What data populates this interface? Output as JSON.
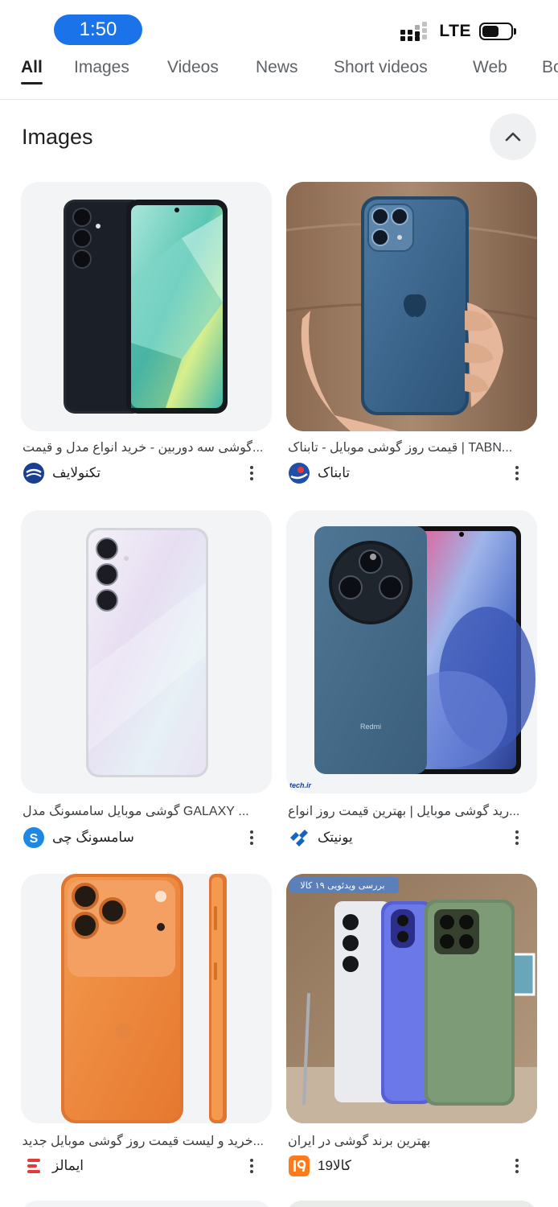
{
  "status_bar": {
    "time": "1:50",
    "network": "LTE"
  },
  "tabs": [
    {
      "label": "All",
      "active": true
    },
    {
      "label": "Images"
    },
    {
      "label": "Videos"
    },
    {
      "label": "News"
    },
    {
      "label": "Short videos"
    },
    {
      "label": "Web"
    },
    {
      "label": "Bo"
    }
  ],
  "section": {
    "title": "Images"
  },
  "results": [
    {
      "caption": "...گوشی سه دوربین - خرید انواع مدل و قیمت",
      "source": "تکنولایف",
      "icon": "technolife-logo"
    },
    {
      "caption": "...TABN | قیمت روز گوشی موبایل - تابناک",
      "source": "تابناک",
      "icon": "tabnak-logo"
    },
    {
      "caption": "... GALAXY گوشی موبایل سامسونگ مدل",
      "source": "سامسونگ چی",
      "icon": "samsungchi-logo"
    },
    {
      "caption": "...رید گوشی موبایل | بهترین قیمت روز انواع",
      "source": "یونیتک",
      "icon": "unitech-logo"
    },
    {
      "caption": "...خرید و لیست قیمت روز گوشی موبایل جدید",
      "source": "ایمالز",
      "icon": "emalls-logo"
    },
    {
      "caption": "بهترین برند گوشی در ایران",
      "source": "19کالا",
      "icon": "19kala-logo"
    }
  ],
  "image_overlays": {
    "unitech_watermark": "tech.ir",
    "video_review_badge": "بررسی ویدئویی ۱۹ کالا"
  },
  "colors": {
    "accent": "#1a73e8",
    "tab_active": "#1f1f1f",
    "tab_inactive": "#5f6368",
    "thumb_bg": "#f3f4f6"
  }
}
